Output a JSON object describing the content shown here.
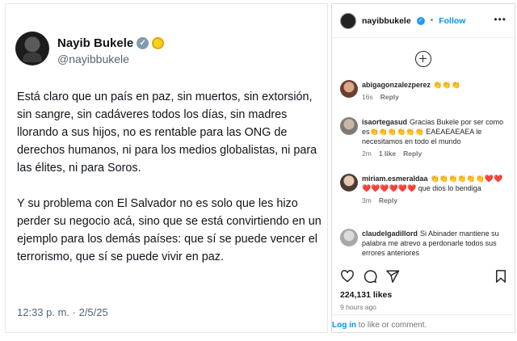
{
  "tweet": {
    "name": "Nayib Bukele",
    "handle": "@nayibbukele",
    "paragraph1": "Está claro que un país en paz, sin muertos, sin extorsión, sin sangre, sin cadáveres todos los días, sin madres llorando a sus hijos, no es rentable para las ONG de derechos humanos, ni para los medios globalistas, ni para las élites, ni para Soros.",
    "paragraph2": "Y su problema con El Salvador no es solo que les hizo perder su negocio acá, sino que se está convirtiendo en un ejemplo para los demás países: que sí se puede vencer el terrorismo, que sí se puede vivir en paz.",
    "timestamp": "12:33 p. m. · 2/5/25"
  },
  "instagram": {
    "username": "nayibbukele",
    "separator": "•",
    "follow_label": "Follow",
    "comments": [
      {
        "user": "abigagonzalezperez",
        "text": "👏👏👏",
        "time": "16s",
        "likes": "",
        "reply": "Reply"
      },
      {
        "user": "isaortegasud",
        "text": "Gracias Bukele por ser como es👏👏👏👏👏👏 EAEAEAEAEA le necesitamos en todo el mundo",
        "time": "2m",
        "likes": "1 like",
        "reply": "Reply"
      },
      {
        "user": "miriam.esmeraldaa",
        "text": "👏👏👏👏👏👏❤️❤️❤️❤️❤️❤️❤️❤️ que dios lo bendiga",
        "time": "3m",
        "likes": "",
        "reply": "Reply"
      },
      {
        "user": "claudelgadillord",
        "text": "Si Abinader mantiene su palabra me atrevo a perdonarle todos sus errores anteriores",
        "time": "",
        "likes": "",
        "reply": ""
      }
    ],
    "likes": "224,131 likes",
    "ago": "9 hours ago",
    "login_link": "Log in",
    "login_rest": " to like or comment."
  },
  "colors": {
    "accent": "#0095f6",
    "twitter_blue": "#1d9bf0",
    "heart": "#ed4956"
  },
  "icons": [
    "verified-icon",
    "coin-icon",
    "more-icon",
    "add-icon",
    "heart-icon",
    "comment-icon",
    "share-icon",
    "save-icon"
  ]
}
